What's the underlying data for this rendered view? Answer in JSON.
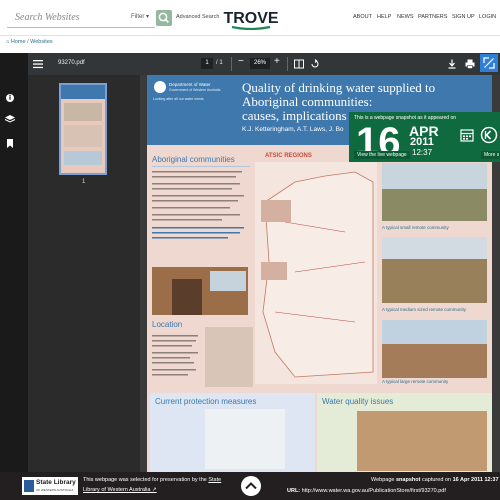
{
  "header": {
    "search_placeholder": "Search Websites",
    "filter_label": "Filter",
    "advanced_search": "Advanced Search",
    "logo_text": "TROVE",
    "nav": [
      "ABOUT",
      "HELP",
      "NEWS",
      "PARTNERS",
      "SIGN UP",
      "LOGIN"
    ]
  },
  "breadcrumb": {
    "home": "Home",
    "current": "Websites"
  },
  "viewer": {
    "file_name": "93270.pdf",
    "page_current": "1",
    "page_total": "1",
    "zoom": "26%"
  },
  "thumbnail": {
    "page_label": "1"
  },
  "document": {
    "dept_line1": "Department of Water",
    "dept_line2": "Government of Western Australia",
    "tagline": "Looking after all our water needs",
    "title_line1": "Quality of drinking water supplied to",
    "title_line2": "Aboriginal communities:",
    "title_line3": "causes, implications",
    "authors": "K.J. Ketteringham, A.T. Laws, J. Bo",
    "sec_aboriginal": "Aboriginal communities",
    "sec_statistics": "ATSIC REGIONS",
    "sec_location": "Location",
    "sec_protection": "Current protection measures",
    "sec_quality": "Water quality issues",
    "cap1": "A typical small remote community",
    "cap2": "A typical medium sized remote community",
    "cap3": "A typical large remote community"
  },
  "snapshot": {
    "notice": "This is a webpage snapshot as it appeared on",
    "day": "16",
    "month": "APR",
    "year": "2011",
    "time": "12:37",
    "view_live": "View the live webpage",
    "more": "More s"
  },
  "footer": {
    "left_text": "This webpage was selected for preservation by the",
    "left_link1": "State",
    "left_link2": "Library of Western Australia",
    "library_name": "State Library",
    "library_sub": "OF WESTERN AUSTRALIA",
    "right_prefix": "Webpage",
    "right_bold": "snapshot",
    "right_mid": "captured on",
    "right_date": "16 Apr 2011 12:37",
    "url_label": "URL:",
    "url": "http://www.water.wa.gov.au/PublicationStore/first/93270.pdf"
  },
  "colors": {
    "trove_green": "#1d8a52",
    "header_blue": "#3f78ad",
    "snapshot_green": "#0f6b3f",
    "toolbar": "#323639"
  }
}
